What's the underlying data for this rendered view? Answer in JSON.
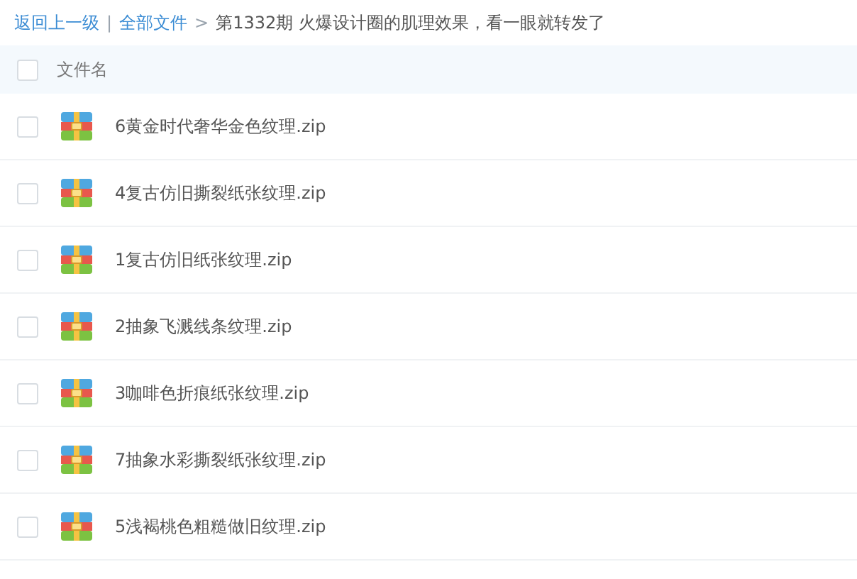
{
  "breadcrumb": {
    "back": "返回上一级",
    "separator": "|",
    "root": "全部文件",
    "arrow": ">",
    "current": "第1332期 火爆设计圈的肌理效果，看一眼就转发了"
  },
  "table": {
    "header": {
      "label": "文件名",
      "checked": false
    },
    "rows": [
      {
        "name": "6黄金时代奢华金色纹理.zip",
        "checked": false
      },
      {
        "name": "4复古仿旧撕裂纸张纹理.zip",
        "checked": false
      },
      {
        "name": "1复古仿旧纸张纹理.zip",
        "checked": false
      },
      {
        "name": "2抽象飞溅线条纹理.zip",
        "checked": false
      },
      {
        "name": "3咖啡色折痕纸张纹理.zip",
        "checked": false
      },
      {
        "name": "7抽象水彩撕裂纸张纹理.zip",
        "checked": false
      },
      {
        "name": "5浅褐桃色粗糙做旧纹理.zip",
        "checked": false
      }
    ]
  }
}
